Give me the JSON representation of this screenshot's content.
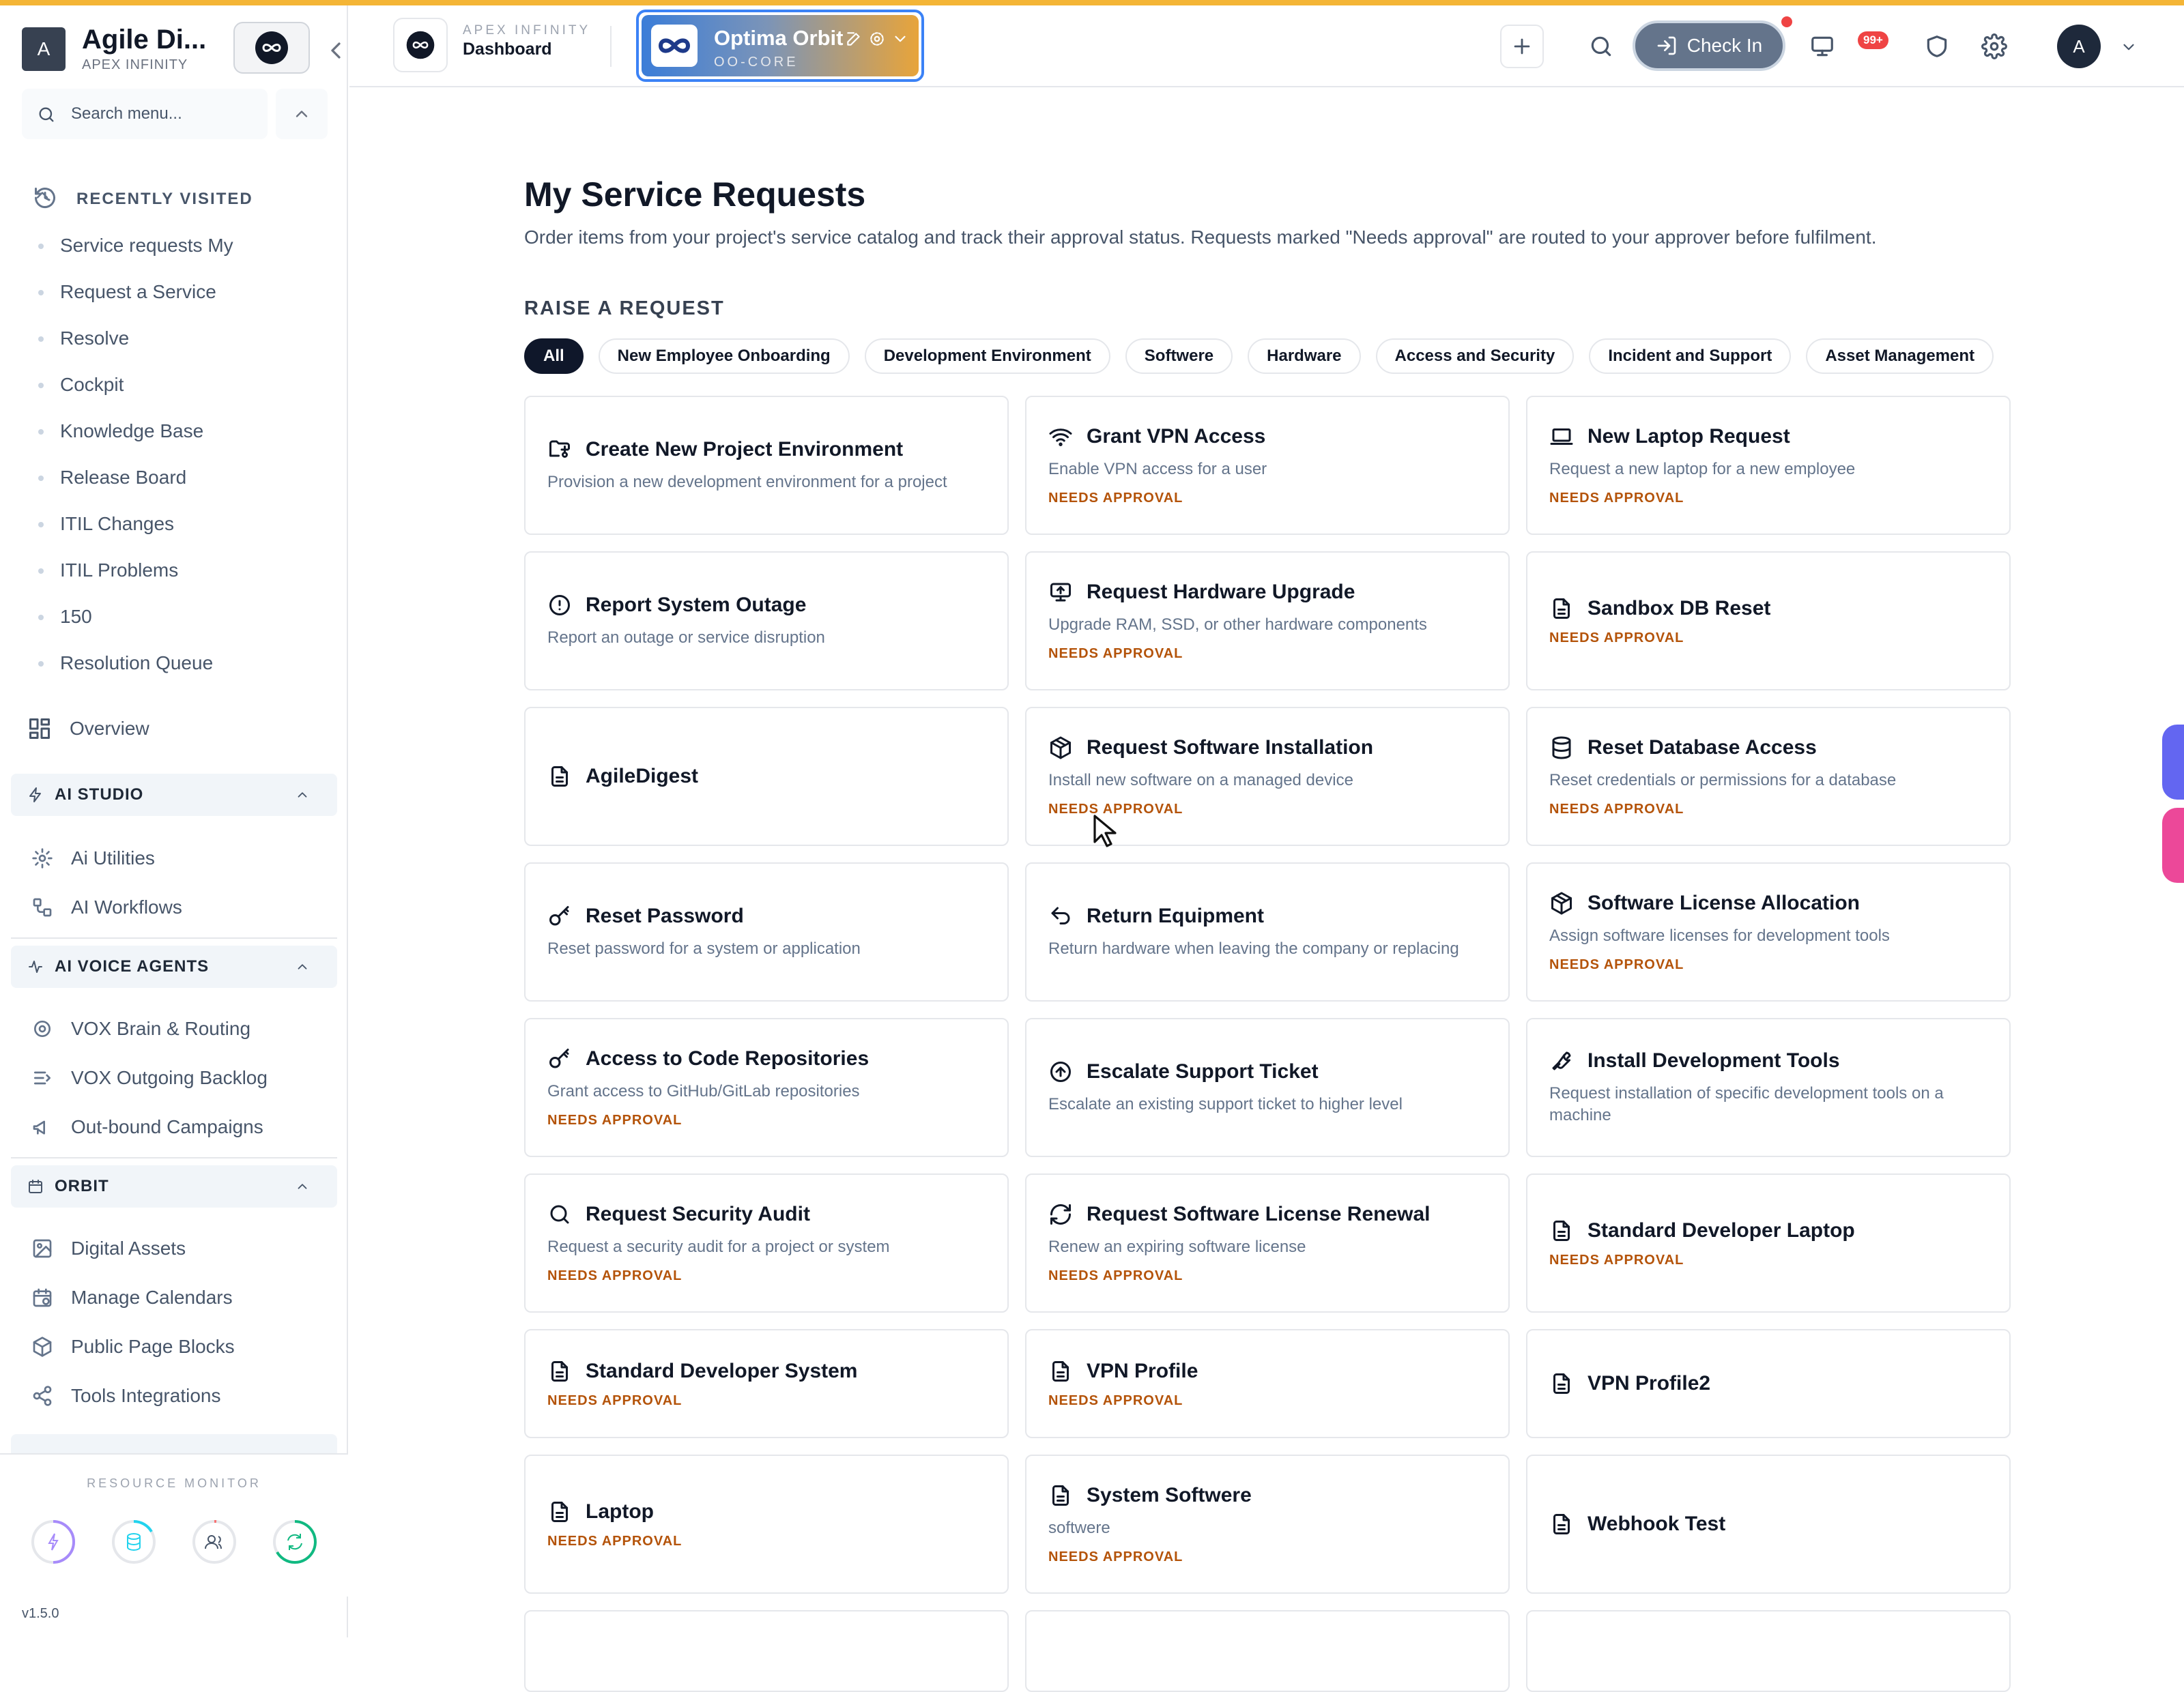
{
  "sidebar": {
    "brand_initial": "A",
    "brand_name": "Agile Di...",
    "brand_sub": "APEX INFINITY",
    "search_placeholder": "Search menu...",
    "recent_title": "RECENTLY VISITED",
    "recent": [
      "Service requests My",
      "Request a Service",
      "Resolve",
      "Cockpit",
      "Knowledge Base",
      "Release Board",
      "ITIL Changes",
      "ITIL Problems",
      "150",
      "Resolution Queue"
    ],
    "overview": "Overview",
    "ai_studio": {
      "title": "AI STUDIO",
      "items": [
        "Ai Utilities",
        "AI Workflows"
      ]
    },
    "ai_voice": {
      "title": "AI VOICE AGENTS",
      "items": [
        "VOX Brain & Routing",
        "VOX Outgoing Backlog",
        "Out-bound Campaigns"
      ]
    },
    "orbit": {
      "title": "ORBIT",
      "items": [
        "Digital Assets",
        "Manage Calendars",
        "Public Page Blocks",
        "Tools Integrations"
      ]
    },
    "monitor_title": "RESOURCE MONITOR",
    "monitor_colors": [
      "#a78bfa",
      "#22d3ee",
      "#f87171",
      "#10b981"
    ],
    "version": "v1.5.0"
  },
  "topbar": {
    "crumb_sup": "APEX INFINITY",
    "crumb_main": "Dashboard",
    "workspace_title": "Optima Orbit",
    "workspace_sub": "OO-CORE",
    "checkin": "Check In",
    "notif_badge": "99+",
    "user_initial": "A"
  },
  "main": {
    "title": "My Service Requests",
    "description": "Order items from your project's service catalog and track their approval status. Requests marked \"Needs approval\" are routed to your approver before fulfilment.",
    "raise_label": "RAISE A REQUEST",
    "chips": [
      "All",
      "New Employee Onboarding",
      "Development Environment",
      "Softwere",
      "Hardware",
      "Access and Security",
      "Incident and Support",
      "Asset Management"
    ],
    "approval_label": "NEEDS APPROVAL",
    "cards": [
      {
        "icon": "folder-git-icon",
        "title": "Create New Project Environment",
        "desc": "Provision a new development environment for a project",
        "approval": false
      },
      {
        "icon": "wifi-icon",
        "title": "Grant VPN Access",
        "desc": "Enable VPN access for a user",
        "approval": true
      },
      {
        "icon": "laptop-icon",
        "title": "New Laptop Request",
        "desc": "Request a new laptop for a new employee",
        "approval": true
      },
      {
        "icon": "alert-circle-icon",
        "title": "Report System Outage",
        "desc": "Report an outage or service disruption",
        "approval": false
      },
      {
        "icon": "monitor-up-icon",
        "title": "Request Hardware Upgrade",
        "desc": "Upgrade RAM, SSD, or other hardware components",
        "approval": true
      },
      {
        "icon": "file-icon",
        "title": "Sandbox DB Reset",
        "desc": "",
        "approval": true
      },
      {
        "icon": "file-icon",
        "title": "AgileDigest",
        "desc": "",
        "approval": false
      },
      {
        "icon": "package-icon",
        "title": "Request Software Installation",
        "desc": "Install new software on a managed device",
        "approval": true
      },
      {
        "icon": "database-icon",
        "title": "Reset Database Access",
        "desc": "Reset credentials or permissions for a database",
        "approval": true
      },
      {
        "icon": "key-icon",
        "title": "Reset Password",
        "desc": "Reset password for a system or application",
        "approval": false
      },
      {
        "icon": "undo-icon",
        "title": "Return Equipment",
        "desc": "Return hardware when leaving the company or replacing",
        "approval": false
      },
      {
        "icon": "package-icon",
        "title": "Software License Allocation",
        "desc": "Assign software licenses for development tools",
        "approval": true
      },
      {
        "icon": "key-icon",
        "title": "Access to Code Repositories",
        "desc": "Grant access to GitHub/GitLab repositories",
        "approval": true
      },
      {
        "icon": "arrow-up-circle-icon",
        "title": "Escalate Support Ticket",
        "desc": "Escalate an existing support ticket to higher level",
        "approval": false
      },
      {
        "icon": "wrench-icon",
        "title": "Install Development Tools",
        "desc": "Request installation of specific development tools on a machine",
        "approval": false
      },
      {
        "icon": "search-icon",
        "title": "Request Security Audit",
        "desc": "Request a security audit for a project or system",
        "approval": true
      },
      {
        "icon": "refresh-icon",
        "title": "Request Software License Renewal",
        "desc": "Renew an expiring software license",
        "approval": true
      },
      {
        "icon": "file-icon",
        "title": "Standard Developer Laptop",
        "desc": "",
        "approval": true
      },
      {
        "icon": "file-icon",
        "title": "Standard Developer System",
        "desc": "",
        "approval": true
      },
      {
        "icon": "file-icon",
        "title": "VPN Profile",
        "desc": "",
        "approval": true
      },
      {
        "icon": "file-icon",
        "title": "VPN Profile2",
        "desc": "",
        "approval": false
      },
      {
        "icon": "file-icon",
        "title": "Laptop",
        "desc": "",
        "approval": true
      },
      {
        "icon": "file-icon",
        "title": "System Softwere",
        "desc": "softwere",
        "approval": true
      },
      {
        "icon": "file-icon",
        "title": "Webhook Test",
        "desc": "",
        "approval": false
      }
    ]
  }
}
